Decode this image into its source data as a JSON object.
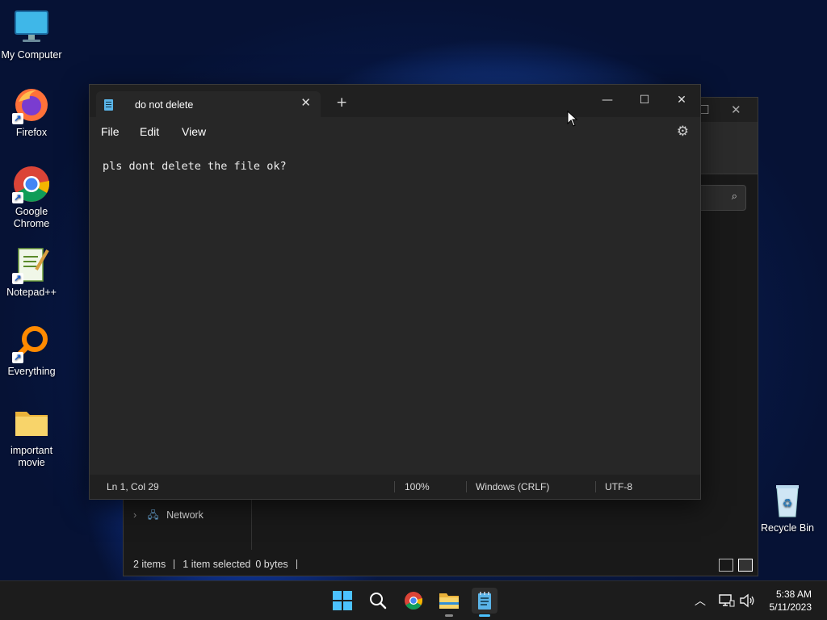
{
  "desktop": {
    "icons": [
      {
        "label": "My Computer"
      },
      {
        "label": "Firefox"
      },
      {
        "label": "Google Chrome"
      },
      {
        "label": "Notepad++"
      },
      {
        "label": "Everything"
      },
      {
        "label": "important movie"
      },
      {
        "label": "Recycle Bin"
      }
    ]
  },
  "explorer": {
    "nav_network": "Network",
    "status": {
      "items": "2 items",
      "selected": "1 item selected",
      "size": "0 bytes"
    }
  },
  "notepad": {
    "tab_title": "do not delete",
    "menu": [
      "File",
      "Edit",
      "View"
    ],
    "content": "pls dont delete the file ok?",
    "status": {
      "position": "Ln 1, Col 29",
      "zoom": "100%",
      "line_ending": "Windows (CRLF)",
      "encoding": "UTF-8"
    }
  },
  "taskbar": {
    "clock": {
      "time": "5:38 AM",
      "date": "5/11/2023"
    }
  },
  "colors": {
    "accent": "#4cc2ff",
    "window_bg": "#272727",
    "titlebar_bg": "#202020",
    "taskbar_bg": "#1c1c1c"
  }
}
